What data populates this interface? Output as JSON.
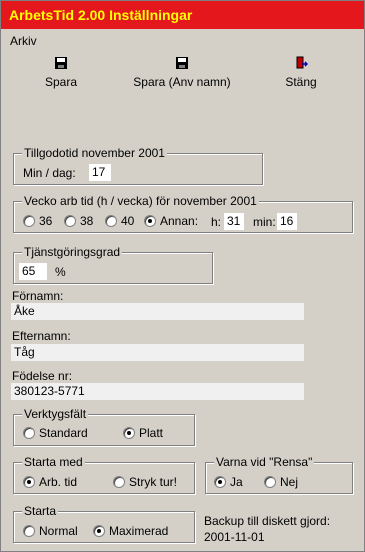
{
  "window": {
    "title": "ArbetsTid 2.00 Inställningar"
  },
  "menu": {
    "arkiv": "Arkiv"
  },
  "toolbar": {
    "save": "Spara",
    "save_as": "Spara (Anv namn)",
    "close": "Stäng"
  },
  "tillgodotid": {
    "legend": "Tillgodotid november 2001",
    "label": "Min / dag:",
    "value": "17"
  },
  "vecko": {
    "legend": "Vecko arb tid (h / vecka) för november 2001",
    "options": [
      "36",
      "38",
      "40",
      "Annan:"
    ],
    "selected": "Annan:",
    "h_label": "h:",
    "h_value": "31",
    "min_label": "min:",
    "min_value": "16"
  },
  "tjanst": {
    "legend": "Tjänstgöringsgrad",
    "value": "65",
    "unit": "%"
  },
  "fornamn": {
    "label": "Förnamn:",
    "value": "Åke"
  },
  "efternamn": {
    "label": "Efternamn:",
    "value": "Tåg"
  },
  "fodelse": {
    "label": "Födelse nr:",
    "value": "380123-5771"
  },
  "verktyg": {
    "legend": "Verktygsfält",
    "opt1": "Standard",
    "opt2": "Platt",
    "selected": "Platt"
  },
  "starta_med": {
    "legend": "Starta med",
    "opt1": "Arb. tid",
    "opt2": "Stryk tur!",
    "selected": "Arb. tid"
  },
  "varna": {
    "legend": "Varna vid  \"Rensa\"",
    "opt1": "Ja",
    "opt2": "Nej",
    "selected": "Ja"
  },
  "starta": {
    "legend": "Starta",
    "opt1": "Normal",
    "opt2": "Maximerad",
    "selected": "Maximerad"
  },
  "backup": {
    "label": "Backup till diskett gjord:",
    "date": "2001-11-01"
  },
  "colors": {
    "titlebar_bg": "#e3171c",
    "titlebar_text": "#ffff00",
    "face": "#d4d0c8"
  }
}
